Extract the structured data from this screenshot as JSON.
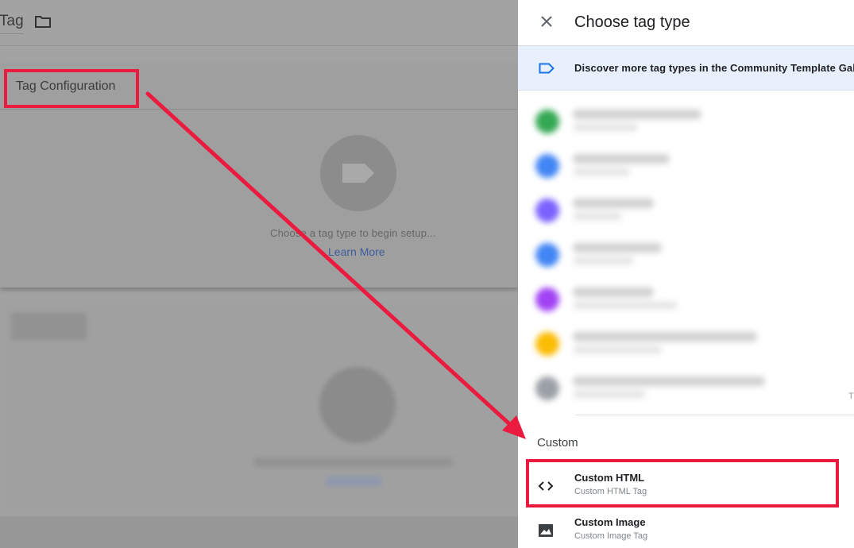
{
  "header": {
    "tag_name": "Tag",
    "folder_icon": "folder-icon"
  },
  "tag_config": {
    "title": "Tag Configuration",
    "hint": "Choose a tag type to begin setup...",
    "learn_more": "Learn More",
    "icon": "tag-icon"
  },
  "drawer": {
    "title": "Choose tag type",
    "close_icon": "close-icon",
    "gallery_banner": "Discover more tag types in the Community Template Gallery",
    "gallery_icon": "label-outline-icon",
    "blurred_row_colors": [
      "#34a853",
      "#4285f4",
      "#7b61ff",
      "#4285f4",
      "#a142f4",
      "#fbbc04",
      "#9aa0a6"
    ],
    "custom_section": "Custom",
    "items": [
      {
        "name": "Custom HTML",
        "description": "Custom HTML Tag",
        "icon": "code-icon"
      },
      {
        "name": "Custom Image",
        "description": "Custom Image Tag",
        "icon": "image-icon"
      }
    ]
  },
  "annotations": {
    "color": "#ea1b3f"
  }
}
